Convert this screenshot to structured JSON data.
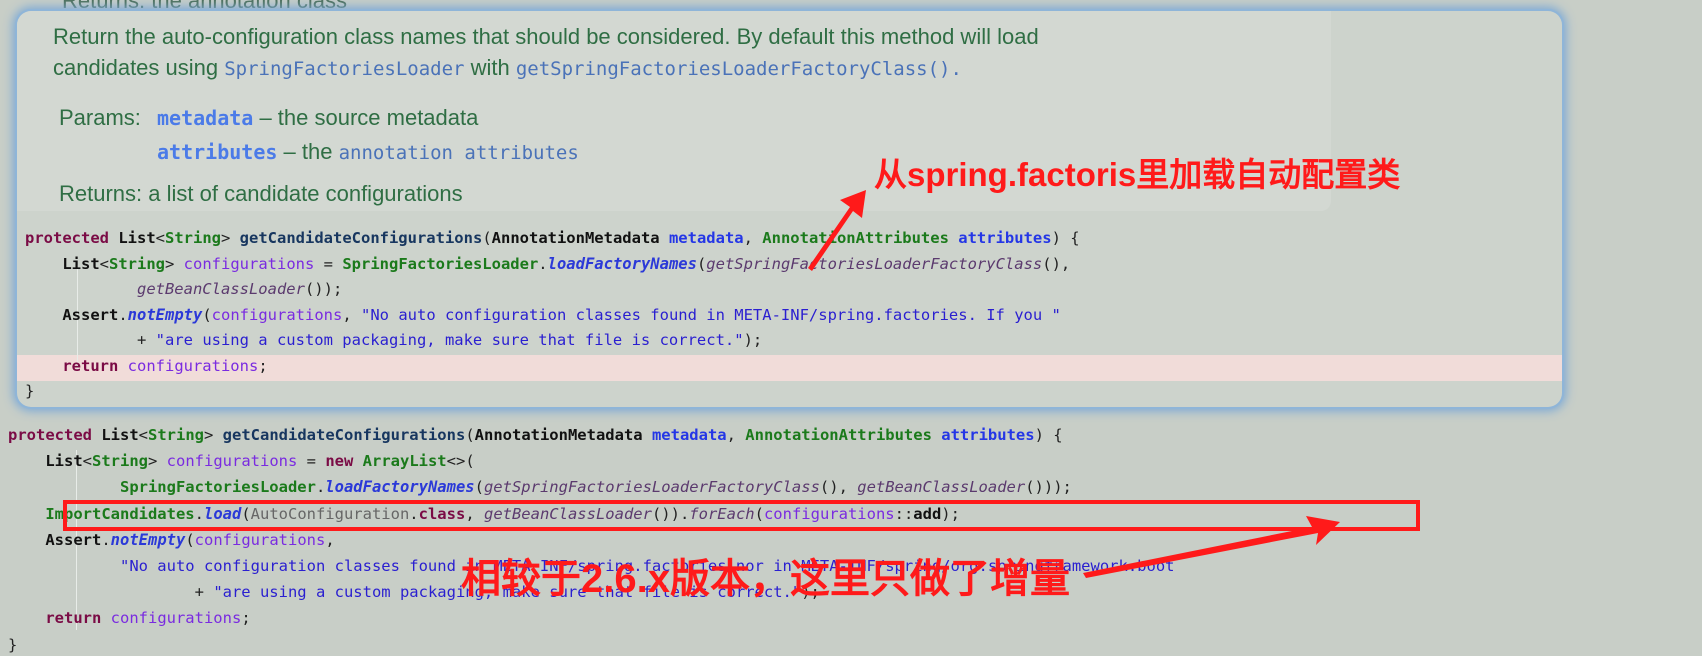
{
  "popup": {
    "cut_line": "Returns: the annotation class",
    "doc": {
      "line1": "Return the auto-configuration class names that should be considered. By default this method will load",
      "line2_pre": "candidates using ",
      "line2_ref1": "SpringFactoriesLoader",
      "line2_mid": " with ",
      "line2_ref2": "getSpringFactoriesLoaderFactoryClass().",
      "params_label": "Params:",
      "param1_name": "metadata",
      "param1_desc": " – the source metadata",
      "param2_name": "attributes",
      "param2_desc": " – the ",
      "param2_ref": "annotation attributes",
      "returns_label": "Returns:",
      "returns_desc": " a list of candidate configurations"
    },
    "code": [
      [
        [
          "kw",
          "protected "
        ],
        [
          "ty",
          "List"
        ],
        [
          "",
          "<"
        ],
        [
          "gt",
          "String"
        ],
        [
          "",
          "> "
        ],
        [
          "mn",
          "getCandidateConfigurations"
        ],
        [
          "",
          "("
        ],
        [
          "ty",
          "AnnotationMetadata "
        ],
        [
          "pr",
          "metadata"
        ],
        [
          "",
          ", "
        ],
        [
          "gt",
          "AnnotationAttributes "
        ],
        [
          "pr",
          "attributes"
        ],
        [
          "",
          ") {"
        ]
      ],
      [
        [
          "",
          "    "
        ],
        [
          "ty",
          "List"
        ],
        [
          "",
          "<"
        ],
        [
          "gt",
          "String"
        ],
        [
          "",
          "> "
        ],
        [
          "va",
          "configurations"
        ],
        [
          "",
          " = "
        ],
        [
          "gt",
          "SpringFactoriesLoader"
        ],
        [
          "",
          "."
        ],
        [
          "sm",
          "loadFactoryNames"
        ],
        [
          "",
          "("
        ],
        [
          "it",
          "getSpringFactoriesLoaderFactoryClass"
        ],
        [
          "",
          "(),"
        ]
      ],
      [
        [
          "",
          "            "
        ],
        [
          "it",
          "getBeanClassLoader"
        ],
        [
          "",
          "());"
        ]
      ],
      [
        [
          "",
          "    "
        ],
        [
          "ty",
          "Assert"
        ],
        [
          "",
          "."
        ],
        [
          "sm",
          "notEmpty"
        ],
        [
          "",
          "("
        ],
        [
          "va",
          "configurations"
        ],
        [
          "",
          ", "
        ],
        [
          "st",
          "\"No auto configuration classes found in META-INF/spring.factories. If you \""
        ]
      ],
      [
        [
          "",
          "            + "
        ],
        [
          "st",
          "\"are using a custom packaging, make sure that file is correct.\""
        ],
        [
          "",
          ");"
        ]
      ],
      [
        [
          "",
          "    "
        ],
        [
          "kw",
          "return "
        ],
        [
          "va",
          "configurations"
        ],
        [
          "",
          ";"
        ]
      ],
      [
        [
          "",
          "}"
        ]
      ]
    ]
  },
  "code": [
    [
      [
        "kw",
        "protected "
      ],
      [
        "ty",
        "List"
      ],
      [
        "",
        "<"
      ],
      [
        "gt",
        "String"
      ],
      [
        "",
        "> "
      ],
      [
        "mn",
        "getCandidateConfigurations"
      ],
      [
        "",
        "("
      ],
      [
        "ty",
        "AnnotationMetadata "
      ],
      [
        "pr",
        "metadata"
      ],
      [
        "",
        ", "
      ],
      [
        "gt",
        "AnnotationAttributes "
      ],
      [
        "pr",
        "attributes"
      ],
      [
        "",
        ") {"
      ]
    ],
    [
      [
        "",
        "    "
      ],
      [
        "ty",
        "List"
      ],
      [
        "",
        "<"
      ],
      [
        "gt",
        "String"
      ],
      [
        "",
        "> "
      ],
      [
        "va",
        "configurations"
      ],
      [
        "",
        " = "
      ],
      [
        "kw",
        "new "
      ],
      [
        "gt",
        "ArrayList"
      ],
      [
        "",
        "<>("
      ]
    ],
    [
      [
        "",
        "            "
      ],
      [
        "gt",
        "SpringFactoriesLoader"
      ],
      [
        "",
        "."
      ],
      [
        "sm",
        "loadFactoryNames"
      ],
      [
        "",
        "("
      ],
      [
        "it",
        "getSpringFactoriesLoaderFactoryClass"
      ],
      [
        "",
        "(), "
      ],
      [
        "it",
        "getBeanClassLoader"
      ],
      [
        "",
        "()));"
      ]
    ],
    [
      [
        "",
        "    "
      ],
      [
        "gt",
        "ImportCandidates"
      ],
      [
        "",
        "."
      ],
      [
        "sm",
        "load"
      ],
      [
        "",
        "("
      ],
      [
        "gr",
        "AutoConfiguration"
      ],
      [
        "",
        "."
      ],
      [
        "kw",
        "class"
      ],
      [
        "",
        ", "
      ],
      [
        "it",
        "getBeanClassLoader"
      ],
      [
        "",
        "())."
      ],
      [
        "it",
        "forEach"
      ],
      [
        "",
        "("
      ],
      [
        "va",
        "configurations"
      ],
      [
        "",
        "::"
      ],
      [
        "ty",
        "add"
      ],
      [
        "",
        ");"
      ]
    ],
    [
      [
        "",
        "    "
      ],
      [
        "ty",
        "Assert"
      ],
      [
        "",
        "."
      ],
      [
        "sm",
        "notEmpty"
      ],
      [
        "",
        "("
      ],
      [
        "va",
        "configurations"
      ],
      [
        "",
        ","
      ]
    ],
    [
      [
        "",
        "            "
      ],
      [
        "st",
        "\"No auto configuration classes found in META-INF/spring.factories nor in META-INF/spring/org.springframework.boot"
      ]
    ],
    [
      [
        "",
        "                    + "
      ],
      [
        "st",
        "\"are using a custom packaging, make sure that file is correct.\""
      ],
      [
        "",
        ");"
      ]
    ],
    [
      [
        "",
        "    "
      ],
      [
        "kw",
        "return "
      ],
      [
        "va",
        "configurations"
      ],
      [
        "",
        ";"
      ]
    ],
    [
      [
        "",
        "}"
      ]
    ]
  ],
  "annotations": {
    "note1": "从spring.factoris里加载自动配置类",
    "note2": "相较于2.6.x版本，这里只做了增量",
    "color": "#ff1a1a"
  }
}
